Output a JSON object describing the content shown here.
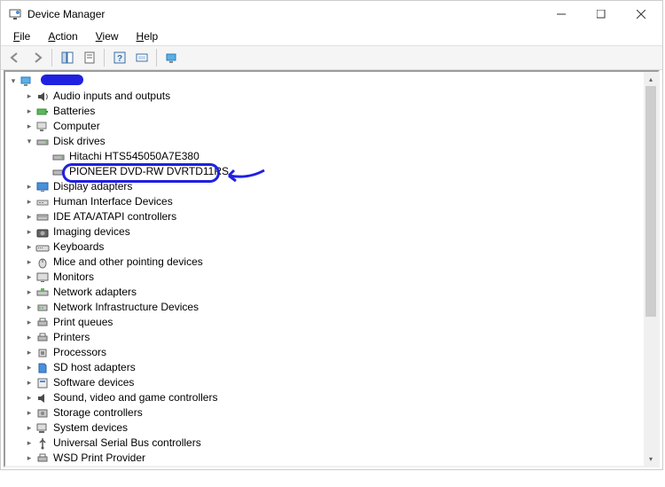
{
  "window": {
    "title": "Device Manager"
  },
  "menu": {
    "file": "File",
    "action": "Action",
    "view": "View",
    "help": "Help"
  },
  "tree": {
    "root_redacted": " ",
    "items": {
      "audio": "Audio inputs and outputs",
      "batteries": "Batteries",
      "computer": "Computer",
      "disk_drives": "Disk drives",
      "disk1": "Hitachi HTS545050A7E380",
      "disk2": "PIONEER DVD-RW DVRTD11RS",
      "display": "Display adapters",
      "hid": "Human Interface Devices",
      "ide": "IDE ATA/ATAPI controllers",
      "imaging": "Imaging devices",
      "keyboards": "Keyboards",
      "mice": "Mice and other pointing devices",
      "monitors": "Monitors",
      "net": "Network adapters",
      "net_infra": "Network Infrastructure Devices",
      "print_queues": "Print queues",
      "printers": "Printers",
      "processors": "Processors",
      "sd": "SD host adapters",
      "software": "Software devices",
      "sound": "Sound, video and game controllers",
      "storage": "Storage controllers",
      "system": "System devices",
      "usb": "Universal Serial Bus controllers",
      "wsd": "WSD Print Provider"
    }
  }
}
